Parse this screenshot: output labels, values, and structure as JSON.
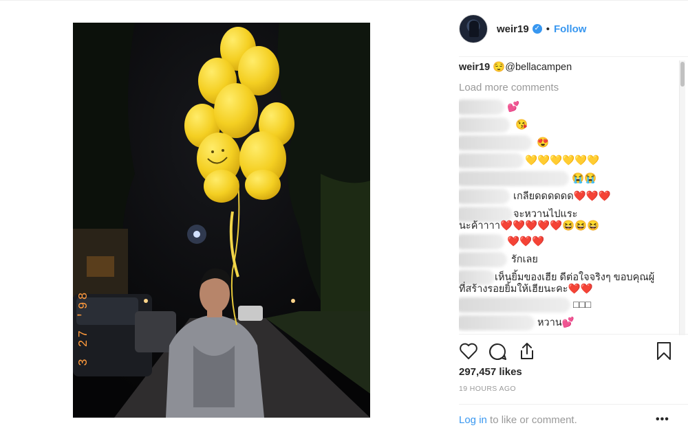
{
  "post": {
    "username": "weir19",
    "verified_icon": "verified-badge-icon",
    "follow_label": "Follow",
    "dot": "•"
  },
  "caption": {
    "username": "weir19",
    "text": "😌@bellacampen"
  },
  "load_more": "Load more comments",
  "comments": [
    {
      "text": "💕"
    },
    {
      "text": "😘"
    },
    {
      "text": "😍"
    },
    {
      "text": "💛💛💛💛💛💛"
    },
    {
      "text": "😭😭"
    },
    {
      "text": "เกลียดดดดดด❤️❤️❤️"
    },
    {
      "text": "จะหวานไปแระ"
    },
    {
      "text": "นะค้าาาา❤️❤️❤️❤️❤️😆😆😆"
    },
    {
      "text": "❤️❤️❤️"
    },
    {
      "text": "รักเลย"
    },
    {
      "text": "เห็นยิ้มของเฮีย ดีต่อใจจริงๆ ขอบคุณผู้"
    },
    {
      "text": "ที่สร้างรอยยิ้มให้เฮียนะคะ❤️❤️"
    },
    {
      "text": "□□□"
    },
    {
      "text": "หวาน💕"
    }
  ],
  "actions": {
    "like_icon": "heart-icon",
    "comment_icon": "comment-icon",
    "share_icon": "share-icon",
    "save_icon": "bookmark-icon"
  },
  "likes": "297,457 likes",
  "timestamp": "19 HOURS AGO",
  "login": {
    "link": "Log in",
    "rest": " to like or comment."
  },
  "more_options": "•••",
  "photo": {
    "date_stamp": "3 27 '98"
  },
  "colors": {
    "accent": "#3897f0",
    "muted": "#999999",
    "balloon": "#f6d12a"
  }
}
